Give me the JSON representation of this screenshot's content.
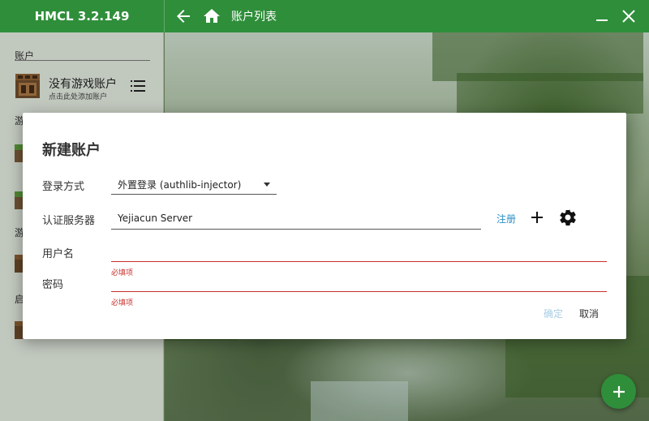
{
  "app": {
    "title": "HMCL 3.2.149"
  },
  "header": {
    "breadcrumb": "账户列表"
  },
  "sidebar": {
    "section_label": "账户",
    "account": {
      "title": "没有游戏账户",
      "subtitle": "点击此处添加账户"
    },
    "peek_labels": [
      "游",
      "游",
      "启"
    ]
  },
  "dialog": {
    "title": "新建账户",
    "login_method_label": "登录方式",
    "login_method_value": "外置登录 (authlib-injector)",
    "auth_server_label": "认证服务器",
    "auth_server_value": "Yejiacun Server",
    "register_link": "注册",
    "username_label": "用户名",
    "password_label": "密码",
    "required_error": "必填项",
    "confirm_label": "确定",
    "cancel_label": "取消"
  },
  "colors": {
    "brand": "#2f8e3a",
    "error": "#c7302c",
    "link": "#2b8fc7"
  },
  "icons": [
    "arrow-left-icon",
    "home-icon",
    "minimize-icon",
    "close-icon",
    "crafting-table-icon",
    "menu-icon",
    "plus-icon",
    "gear-icon",
    "fab-plus-icon"
  ]
}
